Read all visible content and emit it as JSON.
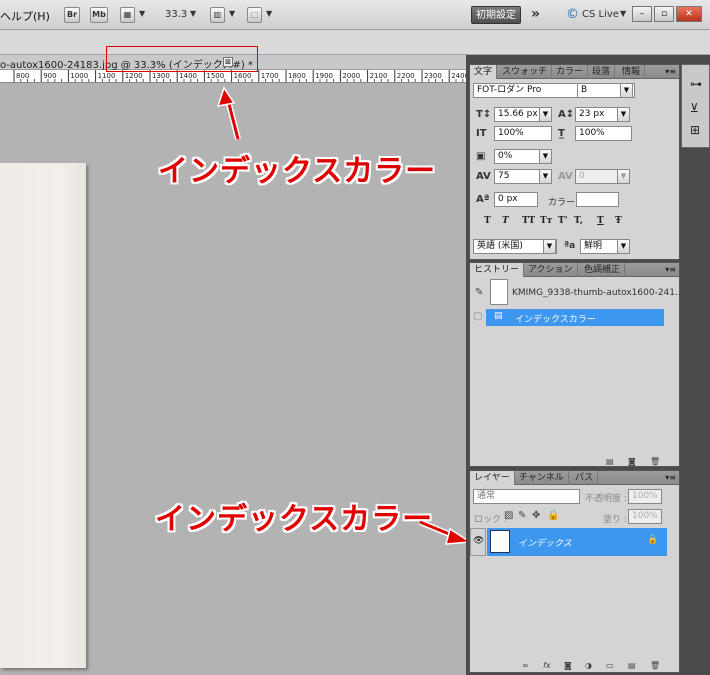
{
  "menubar": {
    "help_menu": "ヘルプ(H)",
    "br_label": "Br",
    "mb_label": "Mb",
    "zoom_value": "33.3",
    "workspace_label": "初期設定",
    "expand_glyph": "»",
    "cs_live_label": "CS Live",
    "minimize_glyph": "–",
    "restore_glyph": "▫",
    "close_glyph": "✕"
  },
  "document": {
    "tab_title": "o-autox1600-24183.jpg @ 33.3% (インデックス#) *",
    "close_glyph": "⊠"
  },
  "ruler": {
    "ticks": [
      "800",
      "900",
      "1000",
      "1100",
      "1200",
      "1300",
      "1400",
      "1500",
      "1600",
      "1700",
      "1800",
      "1900",
      "2000",
      "2100",
      "2200",
      "2300",
      "2400"
    ]
  },
  "annotations": {
    "top_label": "インデックスカラー",
    "bottom_label": "インデックスカラー",
    "color": "#e00000"
  },
  "character_panel": {
    "tabs": [
      "文字",
      "スウォッチ",
      "カラー",
      "段落",
      "情報"
    ],
    "font_family": "FOT-ロダン Pro",
    "font_style": "B",
    "font_size": "15.66 px",
    "leading": "23 px",
    "vertical_scale": "100%",
    "horizontal_scale": "100%",
    "tsume": "0%",
    "tracking": "75",
    "kerning": "0",
    "baseline_shift": "0 px",
    "color_label": "カラー :",
    "type_styles": [
      "T",
      "T",
      "TT",
      "Tт",
      "T'",
      "T,",
      "T",
      "Ŧ"
    ],
    "language": "英語 (米国)",
    "aa_icon": "ªa",
    "antialias": "鮮明"
  },
  "history_panel": {
    "tabs": [
      "ヒストリー",
      "アクション",
      "色調補正"
    ],
    "snapshot_name": "KMIMG_9338-thumb-autox1600-241...",
    "state_name": "インデックスカラー"
  },
  "layers_panel": {
    "tabs": [
      "レイヤー",
      "チャンネル",
      "パス"
    ],
    "blend_mode": "通常",
    "opacity_label": "不透明度 :",
    "opacity_value": "100%",
    "lock_label": "ロック :",
    "fill_label": "塗り :",
    "fill_value": "100%",
    "layer_name": "インデックス",
    "selection_color": "#3d97ef"
  }
}
